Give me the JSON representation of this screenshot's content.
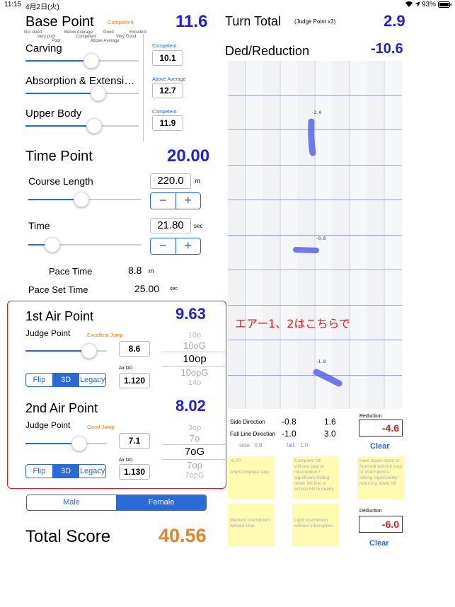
{
  "status": {
    "time": "11:15",
    "date": "4月2日(火)",
    "battery": "93%"
  },
  "base_point": {
    "title": "Base Point",
    "grade": "Competent",
    "value": "11.6",
    "scale_labels": [
      "Not skied",
      "Very poor",
      "Poor",
      "Below Average",
      "Competent",
      "Above Average",
      "Good",
      "Very Good",
      "Excellent"
    ],
    "items": [
      {
        "label": "Carving",
        "grade": "Competent",
        "value": "10.1",
        "level": 0.52
      },
      {
        "label": "Absorption & Extensi…",
        "grade": "Above Average",
        "value": "12.7",
        "level": 0.6
      },
      {
        "label": "Upper Body",
        "grade": "Competent",
        "value": "11.9",
        "level": 0.57
      }
    ]
  },
  "time_point": {
    "title": "Time Point",
    "value": "20.00",
    "course_length": {
      "label": "Course Length",
      "value": "220.0",
      "unit": "m",
      "level": 0.45
    },
    "time": {
      "label": "Time",
      "value": "21.80",
      "unit": "sec",
      "level": 0.2
    },
    "pace_time": {
      "label": "Pace Time",
      "value": "8.8",
      "unit": "m"
    },
    "pace_set_time": {
      "label": "Pace Set Time",
      "value": "25.00",
      "unit": "sec"
    },
    "minus": "−",
    "plus": "+"
  },
  "air1": {
    "title": "1st Air Point",
    "value": "9.63",
    "judge_label": "Judge Point",
    "grade": "Excellent Jump",
    "judge_value": "8.6",
    "level": 0.8,
    "dd_label": "Air DD",
    "dd_value": "1.120",
    "segments": [
      "Flip",
      "3D",
      "Legacy"
    ],
    "selected_segment": "3D",
    "picker": [
      "10o",
      "10oG",
      "10op",
      "10opG",
      "14o"
    ],
    "picker_selected": "10op"
  },
  "air2": {
    "title": "2nd Air Point",
    "value": "8.02",
    "judge_label": "Judge Point",
    "grade": "Good Jump",
    "judge_value": "7.1",
    "level": 0.65,
    "dd_label": "Air DD",
    "dd_value": "1.130",
    "segments": [
      "Flip",
      "3D",
      "Legacy"
    ],
    "selected_segment": "3D",
    "picker": [
      "3op",
      "7o",
      "7oG",
      "7op",
      "7opG"
    ],
    "picker_selected": "7oG"
  },
  "gender": {
    "options": [
      "Male",
      "Female"
    ],
    "selected": "Female"
  },
  "total": {
    "label": "Total Score",
    "value": "40.56"
  },
  "turn_total": {
    "title": "Turn Total",
    "note": "(Judge Point x3)",
    "value": "2.9"
  },
  "deduction": {
    "title": "Ded/Reduction",
    "value": "-10.6",
    "course_marks": [
      "-2.0",
      "-0.8",
      "-1.8"
    ],
    "annotation": "エアー1、2はこちらで",
    "side_direction": {
      "label": "Side Direction",
      "a": "-0.8",
      "b": "1.6"
    },
    "fall_line_direction": {
      "label": "Fall Line Direction",
      "a": "-1.0",
      "b": "3.0"
    },
    "side_fall": {
      "side": "side:  0.8",
      "fall": "fall:   1.0"
    },
    "reduction": {
      "label": "Reduction",
      "value": "-4.6",
      "clear": "Clear"
    },
    "deduction": {
      "label": "Deduction",
      "value": "-6.0",
      "clear": "Clear"
    },
    "boxes": [
      "-6.00\n\nAny Complete stop",
      "Complete fall without stop or interruption / significant sliding down fall line or across hill to nearly",
      "Hard touch down or front roll without stop or interruption / sliding significantly reducing down hill",
      "Medium touchdown without stop",
      "Light touchdown without interruption"
    ]
  },
  "colors": {
    "accent": "#2a6ad8",
    "value_blue": "#1e1ee6",
    "orange": "#f08020",
    "red": "#e02020",
    "yellow": "#fffbb0"
  }
}
